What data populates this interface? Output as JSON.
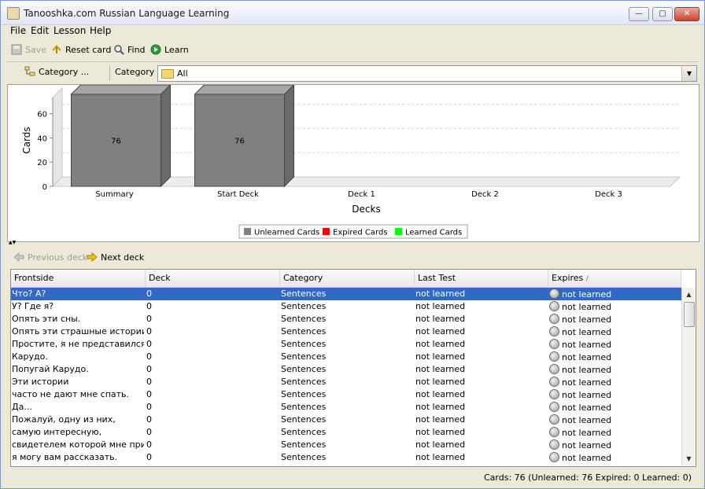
{
  "window": {
    "title": "Tanooshka.com Russian Language Learning"
  },
  "menu": [
    "File",
    "Edit",
    "Lesson",
    "Help"
  ],
  "toolbar": {
    "save": "Save",
    "reset": "Reset card",
    "find": "Find",
    "learn": "Learn"
  },
  "category_bar": {
    "button": "Category ...",
    "label": "Category",
    "selected": "All"
  },
  "chart_data": {
    "type": "bar",
    "categories": [
      "Summary",
      "Start Deck",
      "Deck 1",
      "Deck 2",
      "Deck 3"
    ],
    "values": [
      76,
      76,
      0,
      0,
      0
    ],
    "data_labels": [
      "76",
      "76"
    ],
    "xlabel": "Decks",
    "ylabel": "Cards",
    "ylim": [
      0,
      76
    ],
    "yticks": [
      0,
      20,
      40,
      60
    ],
    "grid": true,
    "legend_position": "bottom",
    "legend": [
      {
        "name": "Unlearned Cards",
        "color": "#808080"
      },
      {
        "name": "Expired Cards",
        "color": "#ff0000"
      },
      {
        "name": "Learned Cards",
        "color": "#00ff00"
      }
    ],
    "bar_color": "#808080"
  },
  "deck_nav": {
    "previous": "Previous deck",
    "next": "Next deck"
  },
  "table": {
    "columns": [
      "Frontside",
      "Deck",
      "Category",
      "Last Test",
      "Expires"
    ],
    "sort_indicator": "/",
    "rows": [
      [
        "Что? А?",
        "0",
        "Sentences",
        "not learned",
        "not learned"
      ],
      [
        "У? Где я?",
        "0",
        "Sentences",
        "not learned",
        "not learned"
      ],
      [
        "Опять эти сны.",
        "0",
        "Sentences",
        "not learned",
        "not learned"
      ],
      [
        "Опять эти страшные истории.",
        "0",
        "Sentences",
        "not learned",
        "not learned"
      ],
      [
        "Простите, я не представился.",
        "0",
        "Sentences",
        "not learned",
        "not learned"
      ],
      [
        "Карудо.",
        "0",
        "Sentences",
        "not learned",
        "not learned"
      ],
      [
        "Попугай Карудо.",
        "0",
        "Sentences",
        "not learned",
        "not learned"
      ],
      [
        "Эти истории",
        "0",
        "Sentences",
        "not learned",
        "not learned"
      ],
      [
        "часто не дают мне спать.",
        "0",
        "Sentences",
        "not learned",
        "not learned"
      ],
      [
        "Да...",
        "0",
        "Sentences",
        "not learned",
        "not learned"
      ],
      [
        "Пожалуй, одну из них,",
        "0",
        "Sentences",
        "not learned",
        "not learned"
      ],
      [
        "самую интересную,",
        "0",
        "Sentences",
        "not learned",
        "not learned"
      ],
      [
        "свидетелем которой мне приш...",
        "0",
        "Sentences",
        "not learned",
        "not learned"
      ],
      [
        "я могу вам рассказать.",
        "0",
        "Sentences",
        "not learned",
        "not learned"
      ]
    ]
  },
  "status": "Cards: 76 (Unlearned: 76  Expired: 0  Learned: 0)"
}
